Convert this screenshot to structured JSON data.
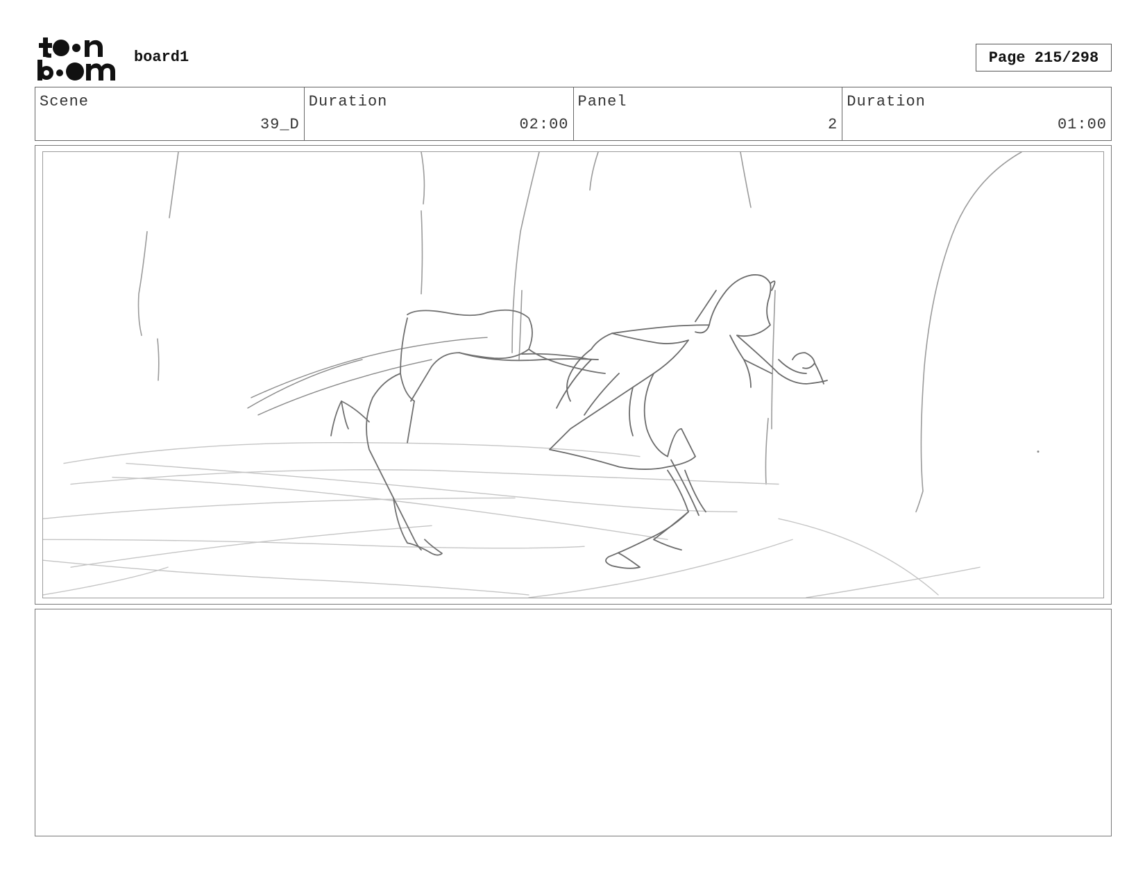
{
  "header": {
    "logo": {
      "icon": "toon-boom-logo",
      "text": "toon boom"
    },
    "project_name": "board1",
    "page_indicator": "Page 215/298"
  },
  "info": [
    {
      "label": "Scene",
      "value": "39_D"
    },
    {
      "label": "Duration",
      "value": "02:00"
    },
    {
      "label": "Panel",
      "value": "2"
    },
    {
      "label": "Duration",
      "value": "01:00"
    }
  ],
  "panel": {
    "image_icon": "sketch-running-figures",
    "notes": ""
  }
}
